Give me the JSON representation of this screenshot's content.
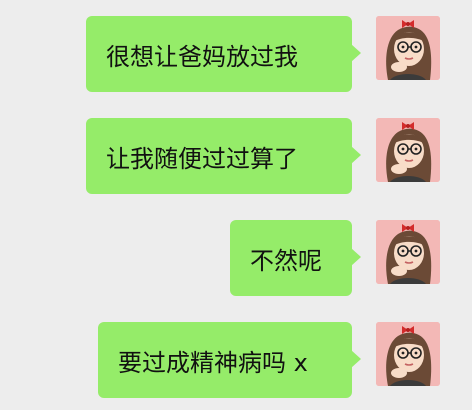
{
  "conversation": {
    "messages": [
      {
        "text": "很想让爸妈放过我",
        "sender": "self",
        "avatar_icon": "girl-avatar"
      },
      {
        "text": "让我随便过过算了",
        "sender": "self",
        "avatar_icon": "girl-avatar"
      },
      {
        "text": "不然呢",
        "sender": "self",
        "avatar_icon": "girl-avatar"
      },
      {
        "text": "要过成精神病吗 x",
        "sender": "self",
        "avatar_icon": "girl-avatar"
      }
    ]
  },
  "colors": {
    "background": "#ededed",
    "bubble": "#95ec69",
    "avatar_background": "#f3b8b6"
  }
}
